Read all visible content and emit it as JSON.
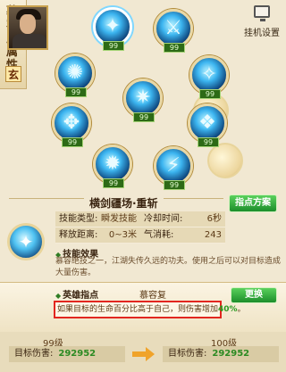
{
  "sidebar_tab": {
    "label": "慕容主属性",
    "element": "玄"
  },
  "hangup_button": {
    "label": "挂机设置"
  },
  "skills": [
    {
      "level": "99",
      "glyph": "✦"
    },
    {
      "level": "99",
      "glyph": "⚔"
    },
    {
      "level": "99",
      "glyph": "✺"
    },
    {
      "level": "99",
      "glyph": "✧"
    },
    {
      "level": "99",
      "glyph": "✷"
    },
    {
      "level": "99",
      "glyph": "✥"
    },
    {
      "level": "99",
      "glyph": "❖"
    },
    {
      "level": "99",
      "glyph": "✹"
    },
    {
      "level": "99",
      "glyph": "⚡"
    },
    {
      "level": "99",
      "glyph": "✶"
    }
  ],
  "skill_detail": {
    "title": "横剑疆场·重斩",
    "plan_button": "指点方案",
    "attributes": {
      "type_label": "技能类型:",
      "type_value": "瞬发技能",
      "cooldown_label": "冷却时间:",
      "cooldown_value": "6秒",
      "range_label": "释放距离:",
      "range_value": "0~3米",
      "qi_label": "气消耗:",
      "qi_value": "243"
    },
    "effect_heading": "技能效果",
    "effect_text": "慕容绝技之一，江湖失传久远的功夫。使用之后可以对目标造成大量伤害。"
  },
  "hero": {
    "heading": "英雄指点",
    "name": "慕容复",
    "change_button": "更换",
    "desc_before": "如果目标的生命百分比高于自己，则伤害增加",
    "desc_pct": "40%",
    "desc_after": "。"
  },
  "comparison": {
    "left_level": "99级",
    "right_level": "100级",
    "damage_label": "目标伤害:",
    "left_damage": "292952",
    "right_damage": "292952"
  }
}
